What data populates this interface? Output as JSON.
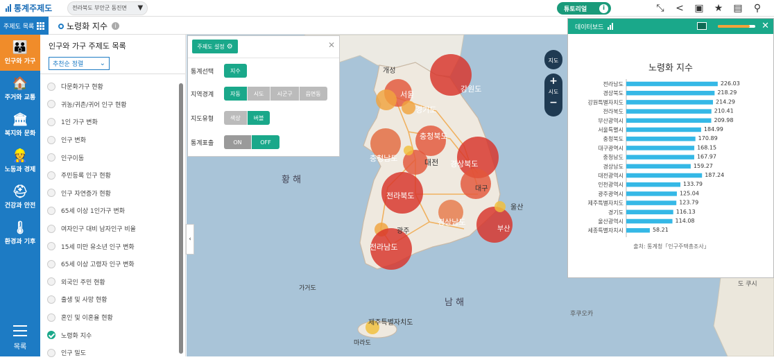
{
  "app": {
    "title": "통계주제도",
    "region": "전라북도 부안군 동진면",
    "tutorial_label": "튜토리얼",
    "info_glyph": "i"
  },
  "toolbar_icons": [
    {
      "name": "shrink-icon",
      "glyph": "⤡"
    },
    {
      "name": "share-icon",
      "glyph": "<"
    },
    {
      "name": "image-icon",
      "glyph": "▣"
    },
    {
      "name": "star-icon",
      "glyph": "★"
    },
    {
      "name": "document-icon",
      "glyph": "▤"
    },
    {
      "name": "pin-add-icon",
      "glyph": "⚲"
    }
  ],
  "subbar": {
    "theme_list_label": "주제도 목록",
    "page_title": "노령화 지수"
  },
  "categories": [
    {
      "label": "인구와 가구",
      "icon": "👪",
      "active": true
    },
    {
      "label": "주거와 교통",
      "icon": "🏠",
      "active": false
    },
    {
      "label": "복지와 문화",
      "icon": "🏛",
      "active": false
    },
    {
      "label": "노동과 경제",
      "icon": "👷",
      "active": false
    },
    {
      "label": "건강과 안전",
      "icon": "⛑",
      "active": false
    },
    {
      "label": "환경과 기후",
      "icon": "🌡",
      "active": false
    }
  ],
  "menu_label": "목록",
  "list_panel": {
    "heading": "인구와 가구 주제도 목록",
    "sort_value": "추천순 정렬",
    "items": [
      {
        "label": "다문화가구 현황",
        "selected": false
      },
      {
        "label": "귀농/귀촌/귀어 인구 현황",
        "selected": false
      },
      {
        "label": "1인 가구 변화",
        "selected": false
      },
      {
        "label": "인구 변화",
        "selected": false
      },
      {
        "label": "인구이동",
        "selected": false
      },
      {
        "label": "주민등록 인구 현황",
        "selected": false
      },
      {
        "label": "인구 자연증가 현황",
        "selected": false
      },
      {
        "label": "65세 이상 1인가구 변화",
        "selected": false
      },
      {
        "label": "여자인구 대비 남자인구 비율",
        "selected": false
      },
      {
        "label": "15세 미만 유소년 인구 변화",
        "selected": false
      },
      {
        "label": "65세 이상 고령자 인구 변화",
        "selected": false
      },
      {
        "label": "외국인 주민 현황",
        "selected": false
      },
      {
        "label": "출생 및 사망 현황",
        "selected": false
      },
      {
        "label": "혼인 및 이혼율 현황",
        "selected": false
      },
      {
        "label": "노령화 지수",
        "selected": true
      },
      {
        "label": "인구 밀도",
        "selected": false
      }
    ]
  },
  "settings": {
    "button_label": "주제도 설정",
    "close_glyph": "✕",
    "rows": [
      {
        "label": "통계선택",
        "options": [
          "지수"
        ],
        "active": 0,
        "style": "single"
      },
      {
        "label": "지역경계",
        "options": [
          "자동",
          "시도",
          "시군구",
          "읍면동"
        ],
        "active": 0,
        "style": "seg"
      },
      {
        "label": "지도유형",
        "options": [
          "색상",
          "버블"
        ],
        "active": 1,
        "style": "seg"
      },
      {
        "label": "통계표출",
        "options": [
          "ON",
          "OFF"
        ],
        "active": 1,
        "style": "toggle"
      }
    ]
  },
  "map": {
    "sea_labels": [
      "황 해",
      "남 해"
    ],
    "place_labels": [
      "개성",
      "서울",
      "경기도",
      "충청북도",
      "대전",
      "충청남도",
      "전라북도",
      "대구",
      "울산",
      "부산",
      "경상남도",
      "광주",
      "전라남도",
      "강원도",
      "경상북도",
      "제주특별자치도",
      "마라도",
      "가거도",
      "후쿠오카",
      "도 쿠시"
    ],
    "controls": {
      "street_label": "지도",
      "zoom_in": "+",
      "level_label": "시도",
      "zoom_out": "−"
    }
  },
  "dashboard": {
    "header_label": "데이터보드",
    "close_glyph": "✕",
    "title": "노령화 지수",
    "source": "출처: 통계청「인구주택총조사」",
    "opacity_value": 0.85
  },
  "colors": {
    "primary": "#1d7bc4",
    "accent": "#1aa88a",
    "active_category": "#f08c2a",
    "bar": "#35b8e6",
    "bubble": "#d8332a"
  },
  "chart_data": {
    "type": "bar",
    "orientation": "horizontal",
    "title": "노령화 지수",
    "categories": [
      "전라남도",
      "경상북도",
      "강원특별자치도",
      "전라북도",
      "부산광역시",
      "서울특별시",
      "충청북도",
      "대구광역시",
      "충청남도",
      "경상남도",
      "대전광역시",
      "인천광역시",
      "광주광역시",
      "제주특별자치도",
      "경기도",
      "울산광역시",
      "세종특별자치시"
    ],
    "values": [
      226.03,
      218.29,
      214.29,
      210.41,
      209.98,
      184.99,
      170.89,
      168.15,
      167.97,
      159.27,
      187.24,
      133.79,
      125.04,
      123.79,
      116.13,
      114.08,
      58.21
    ],
    "value_labels": [
      "226.03",
      "218.29",
      "214.29",
      "210.41",
      "209.98",
      "184.99",
      "170.89",
      "168.15",
      "167.97",
      "159.27",
      "187.24",
      "133.79",
      "125.04",
      "123.79",
      "116.13",
      "114.08",
      "58.21"
    ],
    "xlim": [
      0,
      240
    ]
  }
}
